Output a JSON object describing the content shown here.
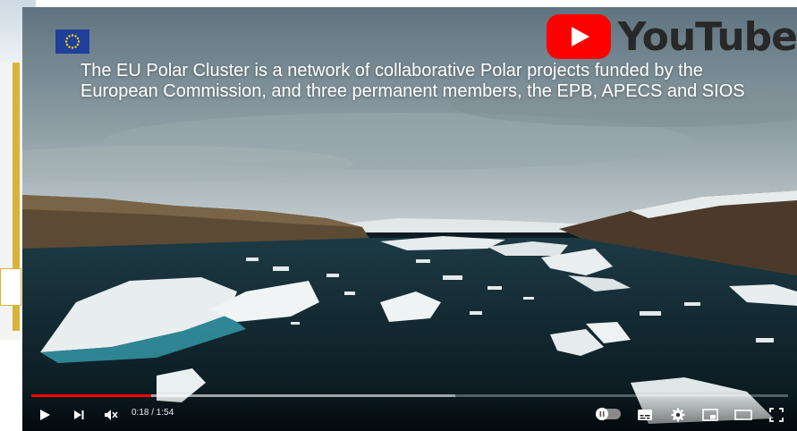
{
  "video": {
    "caption": "The EU Polar Cluster is a network of collaborative Polar projects funded by the European Commission, and three permanent members, the EPB, APECS and SIOS",
    "brand_wordmark": "YouTube",
    "current_time": "0:18",
    "duration": "1:54",
    "time_display": "0:18 / 1:54",
    "progress_played": 0.158,
    "progress_loaded": 0.56,
    "autoplay_on": false
  },
  "controls": {
    "icons": [
      "play-icon",
      "next-icon",
      "mute-icon",
      "autoplay-toggle",
      "subtitles-icon",
      "settings-icon",
      "miniplayer-icon",
      "theater-mode-icon",
      "fullscreen-icon"
    ]
  },
  "colors": {
    "youtube_red": "#ff0000",
    "eu_blue": "#1f3f9a",
    "eu_star": "#ffd400"
  }
}
